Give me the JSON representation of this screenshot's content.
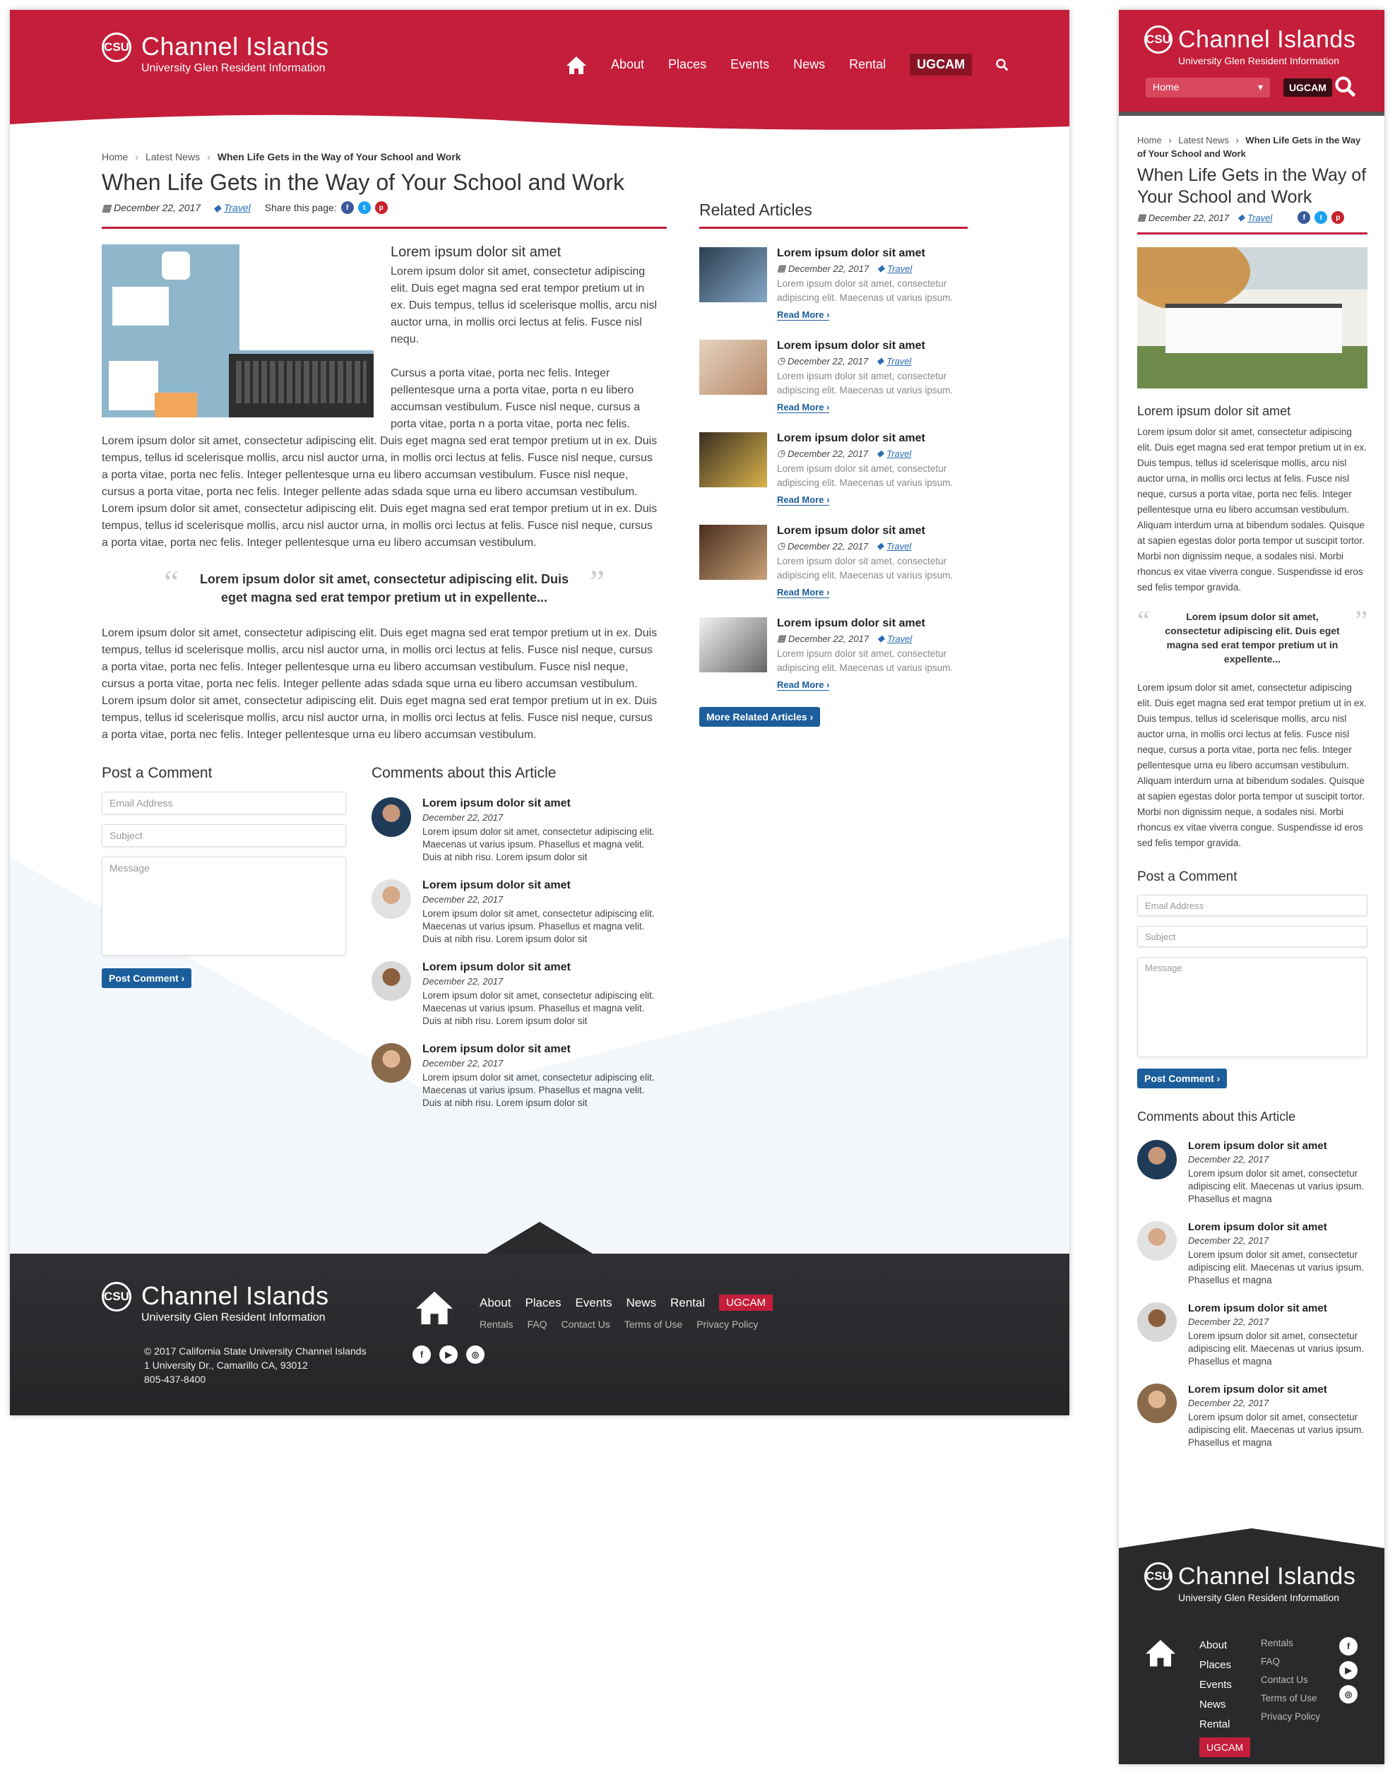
{
  "site": {
    "name": "Channel Islands",
    "tagline": "University Glen Resident Information",
    "logo_mark": "CSU"
  },
  "nav": {
    "items": [
      "About",
      "Places",
      "Events",
      "News",
      "Rental"
    ],
    "ugcam": "UGCAM",
    "mobile_select": "Home"
  },
  "breadcrumb": {
    "home": "Home",
    "section": "Latest News",
    "current": "When Life Gets in the Way of Your School and Work"
  },
  "article": {
    "title": "When Life Gets in the Way of Your School and Work",
    "date": "December 22, 2017",
    "category": "Travel",
    "share_label": "Share this page:",
    "heading": "Lorem ipsum dolor sit amet",
    "p1": "Lorem ipsum dolor sit amet, consectetur adipiscing elit. Duis eget magna sed erat tempor pretium ut in ex. Duis tempus, tellus id scelerisque mollis, arcu nisl auctor urna, in mollis orci lectus at felis. Fusce nisl nequ.",
    "p2": "Cursus a porta vitae, porta nec felis. Integer pellentesque urna a porta vitae, porta n eu libero accumsan vestibulum.  Fusce nisl neque, cursus a porta vitae, porta n a porta vitae, porta nec felis. Lorem ipsum dolor sit amet, consectetur adipiscing elit. Duis eget magna sed erat tempor pretium ut in ex. Duis tempus, tellus id scelerisque mollis, arcu nisl auctor urna, in mollis orci lectus at felis. Fusce nisl neque, cursus a porta vitae, porta nec felis. Integer pellentesque urna eu libero accumsan vestibulum. Fusce nisl neque, cursus a porta vitae, porta nec felis. Integer pellente adas sdada sque urna eu libero accumsan vestibulum. Lorem ipsum dolor sit amet, consectetur adipiscing elit. Duis eget magna sed erat tempor pretium ut in ex. Duis tempus, tellus id scelerisque mollis, arcu nisl auctor urna, in mollis orci lectus at felis. Fusce nisl neque, cursus a porta vitae, porta nec felis. Integer pellentesque urna eu libero accumsan vestibulum.",
    "quote": "Lorem ipsum dolor sit amet, consectetur adipiscing elit. Duis eget magna sed erat tempor pretium ut in expellente...",
    "p3": "Lorem ipsum dolor sit amet, consectetur adipiscing elit. Duis eget magna sed erat tempor pretium ut in ex. Duis tempus, tellus id scelerisque mollis, arcu nisl auctor urna, in mollis orci lectus at felis. Fusce nisl neque, cursus a porta vitae, porta nec felis. Integer pellentesque urna eu libero accumsan vestibulum. Fusce nisl neque, cursus a porta vitae, porta nec felis. Integer pellente adas sdada sque urna eu libero accumsan vestibulum. Lorem ipsum dolor sit amet, consectetur adipiscing elit. Duis eget magna sed erat tempor pretium ut in ex. Duis tempus, tellus id scelerisque mollis, arcu nisl auctor urna, in mollis orci lectus at felis. Fusce nisl neque, cursus a porta vitae, porta nec felis. Integer pellentesque urna eu libero accumsan vestibulum.",
    "m_p1": "Lorem ipsum dolor sit amet, consectetur adipiscing elit. Duis eget magna sed erat tempor pretium ut in ex. Duis tempus, tellus id scelerisque mollis, arcu nisl auctor urna, in mollis orci lectus at felis. Fusce nisl neque, cursus a porta vitae, porta nec felis. Integer pellentesque urna eu libero accumsan vestibulum. Aliquam interdum urna at bibendum sodales. Quisque at sapien egestas dolor porta tempor ut suscipit tortor. Morbi non dignissim neque, a sodales nisi. Morbi rhoncus ex vitae viverra congue. Suspendisse id eros sed felis tempor gravida.",
    "m_quote": "Lorem ipsum dolor sit amet, consectetur adipiscing elit. Duis eget magna sed erat tempor pretium ut in expellente..."
  },
  "related": {
    "title": "Related Articles",
    "item_title": "Lorem ipsum dolor sit amet",
    "item_text": "Lorem ipsum dolor sit amet, consectetur adipiscing elit. Maecenas ut varius ipsum.",
    "read_more": "Read More",
    "more_button": "More Related Articles"
  },
  "comment_form": {
    "title": "Post a Comment",
    "email": "Email Address",
    "subject": "Subject",
    "message": "Message",
    "button": "Post Comment"
  },
  "comments": {
    "title": "Comments about this Article",
    "item_title": "Lorem ipsum dolor sit amet",
    "item_text": "Lorem ipsum dolor sit amet, consectetur adipiscing elit. Maecenas ut varius ipsum. Phasellus et magna velit. Duis at nibh risu.  Lorem ipsum dolor sit",
    "m_item_text": "Lorem ipsum dolor sit amet, consectetur adipiscing elit. Maecenas ut varius ipsum. Phasellus et magna"
  },
  "footer": {
    "copyright": "© 2017 California State University Channel Islands",
    "address": "1 University Dr., Camarillo CA, 93012",
    "phone": "805-437-8400",
    "links": [
      "About",
      "Places",
      "Events",
      "News",
      "Rental"
    ],
    "sublinks": [
      "Rentals",
      "FAQ",
      "Contact Us",
      "Terms of Use",
      "Privacy Policy"
    ],
    "ugcam": "UGCAM"
  },
  "colors": {
    "brand": "#c41e3a",
    "link": "#1b5e9b",
    "footer": "#2a2a2d"
  },
  "icons": [
    "home-icon",
    "search-icon",
    "calendar-icon",
    "tag-icon",
    "facebook-icon",
    "twitter-icon",
    "pinterest-icon",
    "youtube-icon",
    "instagram-icon",
    "clock-icon",
    "quote-icon"
  ]
}
